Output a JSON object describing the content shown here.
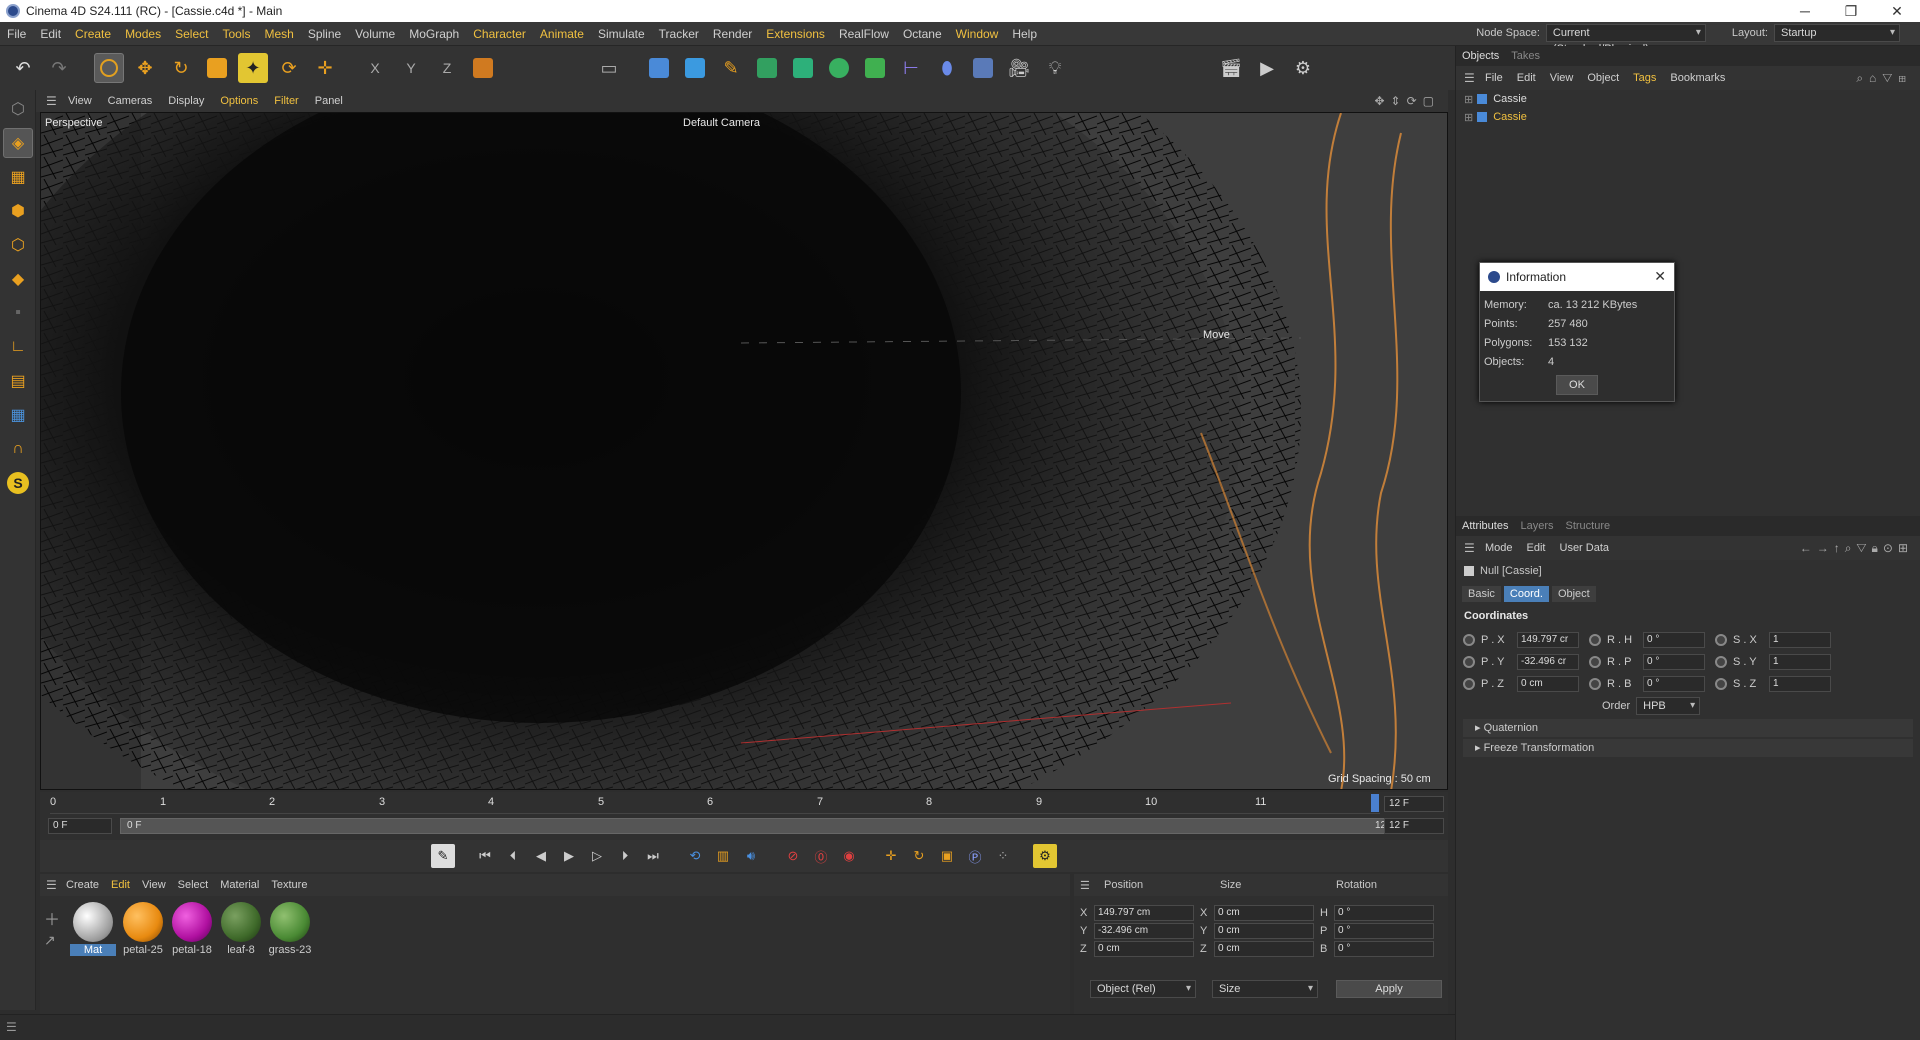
{
  "window": {
    "title": "Cinema 4D S24.111 (RC) - [Cassie.c4d *] - Main"
  },
  "menubar": {
    "items": [
      "File",
      "Edit",
      "Create",
      "Modes",
      "Select",
      "Tools",
      "Mesh",
      "Spline",
      "Volume",
      "MoGraph",
      "Character",
      "Animate",
      "Simulate",
      "Tracker",
      "Render",
      "Extensions",
      "RealFlow",
      "Octane",
      "Window",
      "Help"
    ],
    "node_space_label": "Node Space:",
    "node_space_value": "Current (Standard/Physical)",
    "layout_label": "Layout:",
    "layout_value": "Startup"
  },
  "viewport": {
    "menu": [
      "View",
      "Cameras",
      "Display",
      "Options",
      "Filter",
      "Panel"
    ],
    "name": "Perspective",
    "camera": "Default Camera",
    "tool_hint": "Move",
    "grid_spacing": "Grid Spacing : 50 cm"
  },
  "timeline": {
    "ticks": [
      "0",
      "1",
      "2",
      "3",
      "4",
      "5",
      "6",
      "7",
      "8",
      "9",
      "10",
      "11"
    ],
    "current_frame": "12 F",
    "start_field": "0 F",
    "range_start": "0 F",
    "range_end": "12 F",
    "end_field": "12 F"
  },
  "materials": {
    "menu": [
      "Create",
      "Edit",
      "View",
      "Select",
      "Material",
      "Texture"
    ],
    "items": [
      {
        "name": "Mat",
        "color": "#e8e8e8"
      },
      {
        "name": "petal-25",
        "color": "#e88a10"
      },
      {
        "name": "petal-18",
        "color": "#b010a0"
      },
      {
        "name": "leaf-8",
        "color": "#3f6a2a"
      },
      {
        "name": "grass-23",
        "color": "#4a8a34"
      }
    ]
  },
  "coords": {
    "headers": [
      "Position",
      "Size",
      "Rotation"
    ],
    "rows": [
      {
        "axis": "X",
        "pos": "149.797 cm",
        "saxis": "X",
        "size": "0 cm",
        "raxis": "H",
        "rot": "0 °"
      },
      {
        "axis": "Y",
        "pos": "-32.496 cm",
        "saxis": "Y",
        "size": "0 cm",
        "raxis": "P",
        "rot": "0 °"
      },
      {
        "axis": "Z",
        "pos": "0 cm",
        "saxis": "Z",
        "size": "0 cm",
        "raxis": "B",
        "rot": "0 °"
      }
    ],
    "mode": "Object (Rel)",
    "size_mode": "Size",
    "apply": "Apply"
  },
  "objects_panel": {
    "tabs": [
      "Objects",
      "Takes"
    ],
    "menu": [
      "File",
      "Edit",
      "View",
      "Object",
      "Tags",
      "Bookmarks"
    ],
    "items": [
      "Cassie",
      "Cassie"
    ]
  },
  "info_dialog": {
    "title": "Information",
    "rows": [
      {
        "k": "Memory:",
        "v": "ca. 13 212 KBytes"
      },
      {
        "k": "Points:",
        "v": "257 480"
      },
      {
        "k": "Polygons:",
        "v": "153 132"
      },
      {
        "k": "Objects:",
        "v": "4"
      }
    ],
    "ok": "OK"
  },
  "attributes": {
    "tabs": [
      "Attributes",
      "Layers",
      "Structure"
    ],
    "menu": [
      "Mode",
      "Edit",
      "User Data"
    ],
    "object": "Null [Cassie]",
    "subtabs": [
      "Basic",
      "Coord.",
      "Object"
    ],
    "section": "Coordinates",
    "rows": [
      {
        "p": "P . X",
        "pv": "149.797 cr",
        "r": "R . H",
        "rv": "0 °",
        "s": "S . X",
        "sv": "1"
      },
      {
        "p": "P . Y",
        "pv": "-32.496 cr",
        "r": "R . P",
        "rv": "0 °",
        "s": "S . Y",
        "sv": "1"
      },
      {
        "p": "P . Z",
        "pv": "0 cm",
        "r": "R . B",
        "rv": "0 °",
        "s": "S . Z",
        "sv": "1"
      }
    ],
    "order_label": "Order",
    "order_value": "HPB",
    "folds": [
      "Quaternion",
      "Freeze Transformation"
    ]
  },
  "colors": {
    "accent": "#f0c040",
    "selection": "#4a7fb8",
    "orange_wire": "#d88a3a"
  }
}
